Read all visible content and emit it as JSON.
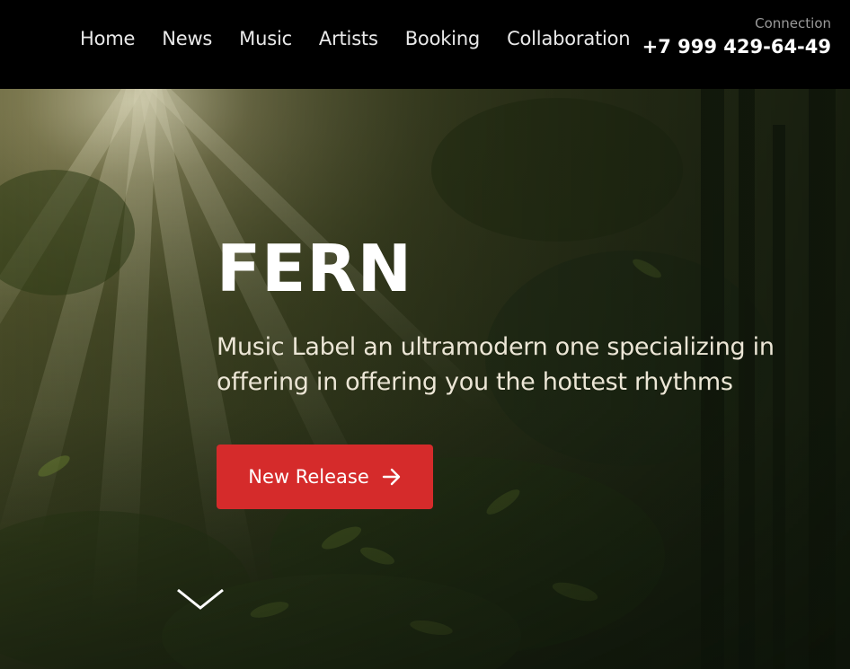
{
  "nav": {
    "items": [
      {
        "label": "Home"
      },
      {
        "label": "News"
      },
      {
        "label": "Music"
      },
      {
        "label": "Artists"
      },
      {
        "label": "Booking"
      },
      {
        "label": "Collaboration"
      }
    ]
  },
  "contact": {
    "label": "Connection",
    "phone": "+7 999 429-64-49"
  },
  "hero": {
    "title": "FERN",
    "subtitle": "Music Label an ultramodern one specializing in offering in offering you the hottest rhythms",
    "cta_label": "New Release",
    "cta_icon": "arrow-right-icon",
    "scroll_icon": "chevron-down-icon",
    "background": "forest-sunbeams-image"
  },
  "colors": {
    "header_bg": "#000000",
    "accent": "#d52b2b",
    "nav_text": "#e9e9e9",
    "muted": "#9a9a9a"
  }
}
